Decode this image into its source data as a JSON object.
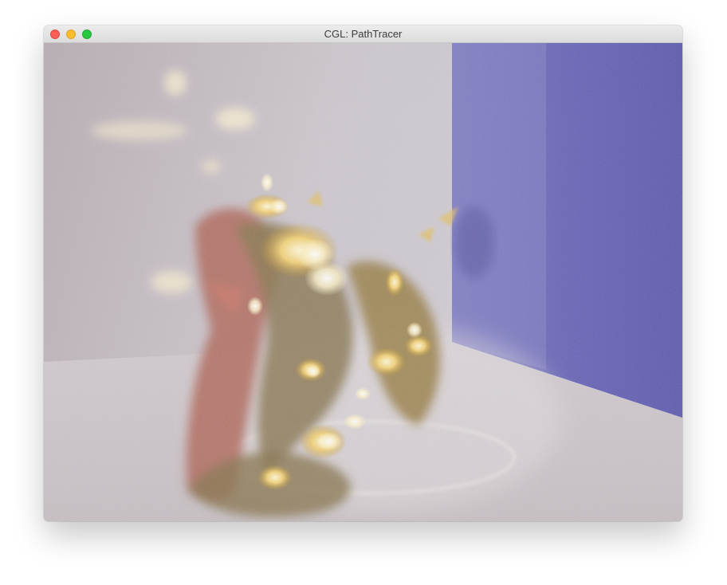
{
  "window": {
    "title": "CGL: PathTracer",
    "controls": [
      "close-button",
      "minimize-button",
      "zoom-button"
    ]
  },
  "render": {
    "scene": "dragon",
    "colors": {
      "back_wall": "#c9c2c8",
      "right_wall": "#6a66b8",
      "floor": "#d8d2d6",
      "gold": "#d9b24a",
      "dragon_red": "#b66a62"
    }
  }
}
